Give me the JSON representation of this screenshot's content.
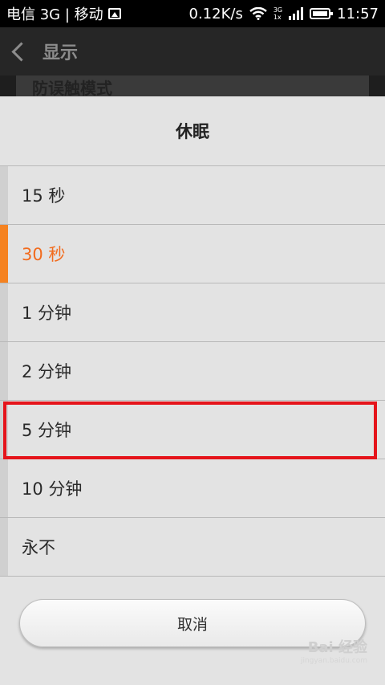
{
  "statusbar": {
    "carrier": "电信 3G | 移动",
    "speed": "0.12K/s",
    "net_top": "3G",
    "net_bottom": "1x",
    "time": "11:57"
  },
  "appbar": {
    "title": "显示"
  },
  "underlying": {
    "row_label": "防误触模式"
  },
  "dialog": {
    "title": "休眠",
    "options": [
      {
        "label": "15 秒"
      },
      {
        "label": "30 秒"
      },
      {
        "label": "1 分钟"
      },
      {
        "label": "2 分钟"
      },
      {
        "label": "5 分钟"
      },
      {
        "label": "10 分钟"
      },
      {
        "label": "永不"
      }
    ],
    "selected_index": 1,
    "cancel_label": "取消",
    "accent_color": "#f58220",
    "highlight_color": "#e5141b"
  },
  "watermark": {
    "text": "Bai 经验",
    "sub": "jingyan.baidu.com"
  }
}
